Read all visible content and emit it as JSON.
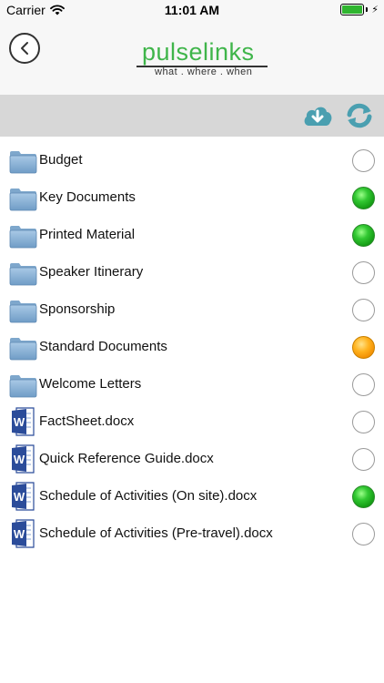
{
  "status_bar": {
    "carrier": "Carrier",
    "time": "11:01 AM",
    "battery_percent": 100,
    "icons": [
      "wifi-icon",
      "battery-icon",
      "charging-icon"
    ]
  },
  "header": {
    "back_icon": "chevron-left-icon",
    "logo_main": "pulselinks",
    "logo_sub": "what . where . when",
    "brand_color": "#3fb54a"
  },
  "toolbar": {
    "icons": [
      "download-icon",
      "refresh-icon"
    ],
    "accent_color": "#4a9fb0"
  },
  "items": [
    {
      "label": "Budget",
      "type": "folder",
      "status": "empty"
    },
    {
      "label": "Key Documents",
      "type": "folder",
      "status": "green"
    },
    {
      "label": "Printed Material",
      "type": "folder",
      "status": "green"
    },
    {
      "label": "Speaker Itinerary",
      "type": "folder",
      "status": "empty"
    },
    {
      "label": "Sponsorship",
      "type": "folder",
      "status": "empty"
    },
    {
      "label": "Standard Documents",
      "type": "folder",
      "status": "orange"
    },
    {
      "label": "Welcome Letters",
      "type": "folder",
      "status": "empty"
    },
    {
      "label": "FactSheet.docx",
      "type": "word",
      "status": "empty"
    },
    {
      "label": "Quick Reference Guide.docx",
      "type": "word",
      "status": "empty"
    },
    {
      "label": "Schedule of Activities (On site).docx",
      "type": "word",
      "status": "green"
    },
    {
      "label": "Schedule of Activities (Pre-travel).docx",
      "type": "word",
      "status": "empty"
    }
  ]
}
